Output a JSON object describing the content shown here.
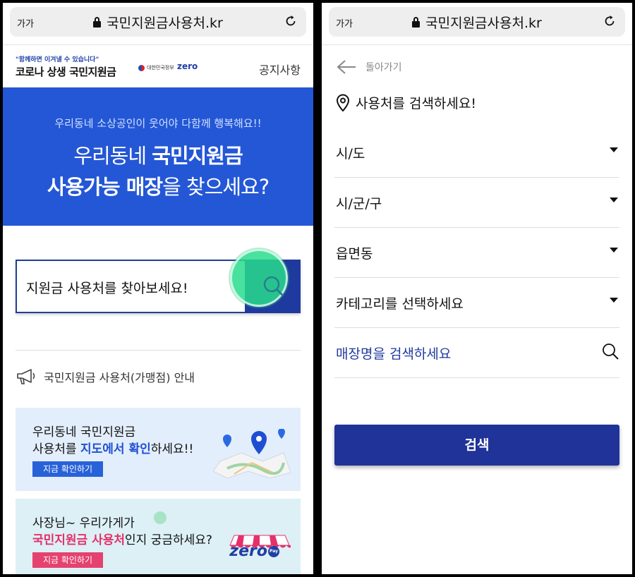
{
  "browser": {
    "text_size_label": "가가",
    "url": "국민지원금사용처.kr"
  },
  "left": {
    "header": {
      "slogan": "\"함께하면 이겨낼 수 있습니다\"",
      "brand": "코로나 상생 국민지원금",
      "gov_label": "대한민국정부",
      "zero_logo": "zero",
      "notice_link": "공지사항"
    },
    "banner": {
      "subtitle": "우리동네 소상공인이 웃어야 다함께 행복해요!!",
      "line1_pre": "우리동네 ",
      "line1_bold": "국민지원금",
      "line2_bold": "사용가능 매장",
      "line2_post": "을 찾으세요?"
    },
    "search": {
      "placeholder": "지원금 사용처를 찾아보세요!"
    },
    "guide_label": "국민지원금 사용처(가맹점) 안내",
    "card1": {
      "line1": "우리동네 국민지원금",
      "line2_pre": "사용처를 ",
      "line2_bold": "지도에서 확인",
      "line2_post": "하세요!!",
      "button": "지금 확인하기"
    },
    "card2": {
      "line1": "사장님~ 우리가게가",
      "line2_bold": "국민지원금 사용처",
      "line2_post": "인지 궁금하세요?",
      "button": "지금 확인하기",
      "logo": "zero",
      "logo_badge": "Pay"
    }
  },
  "right": {
    "back_label": "돌아가기",
    "title": "사용처를 검색하세요!",
    "selects": [
      {
        "label": "시/도"
      },
      {
        "label": "시/군/구"
      },
      {
        "label": "읍면동"
      },
      {
        "label": "카테고리를 선택하세요"
      }
    ],
    "store_search_label": "매장명을 검색하세요",
    "submit": "검색"
  },
  "colors": {
    "banner": "#2457d6",
    "navy": "#1f3399",
    "pink": "#e5306a"
  }
}
